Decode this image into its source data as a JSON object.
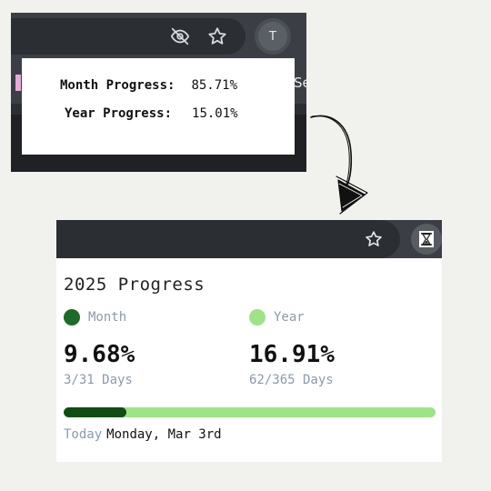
{
  "colors": {
    "month_accent": "#1e6a27",
    "year_accent": "#9ee486",
    "bar_fill": "#0f4d14",
    "bar_track": "#9ee486",
    "muted_text": "#8a9aae",
    "chrome_dark": "#2b2e33"
  },
  "old_version": {
    "avatar_letter": "T",
    "bookmark_text": "Se",
    "icons": [
      "eye-off-icon",
      "star-icon"
    ],
    "popup": {
      "month_label": "Month Progress:",
      "month_value": "85.71%",
      "year_label": "Year Progress:",
      "year_value": "15.01%"
    }
  },
  "new_version": {
    "icons": [
      "star-icon",
      "hourglass-icon"
    ],
    "title": "2025 Progress",
    "month": {
      "label": "Month",
      "percent": "9.68%",
      "days": "3/31 Days"
    },
    "year": {
      "label": "Year",
      "percent": "16.91%",
      "days": "62/365 Days"
    },
    "progress_fraction": 0.1691,
    "today_label": "Today",
    "today_date": "Monday, Mar 3rd"
  }
}
